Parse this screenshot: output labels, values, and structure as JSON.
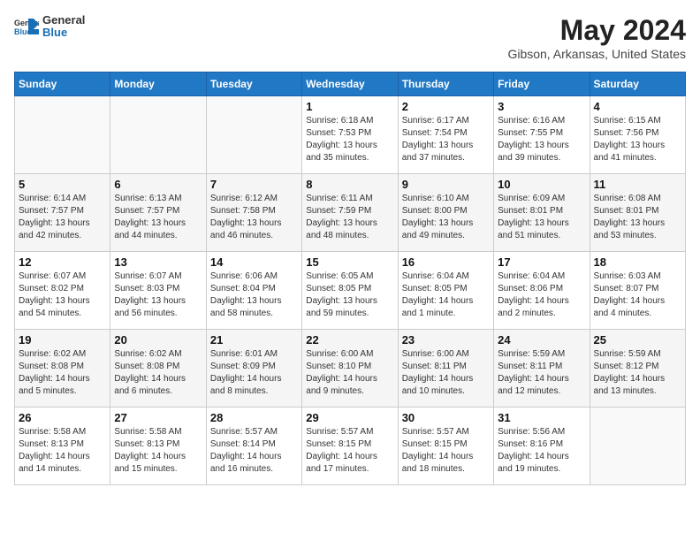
{
  "header": {
    "logo_general": "General",
    "logo_blue": "Blue",
    "month_year": "May 2024",
    "location": "Gibson, Arkansas, United States"
  },
  "days_of_week": [
    "Sunday",
    "Monday",
    "Tuesday",
    "Wednesday",
    "Thursday",
    "Friday",
    "Saturday"
  ],
  "weeks": [
    [
      {
        "day": "",
        "info": ""
      },
      {
        "day": "",
        "info": ""
      },
      {
        "day": "",
        "info": ""
      },
      {
        "day": "1",
        "info": "Sunrise: 6:18 AM\nSunset: 7:53 PM\nDaylight: 13 hours\nand 35 minutes."
      },
      {
        "day": "2",
        "info": "Sunrise: 6:17 AM\nSunset: 7:54 PM\nDaylight: 13 hours\nand 37 minutes."
      },
      {
        "day": "3",
        "info": "Sunrise: 6:16 AM\nSunset: 7:55 PM\nDaylight: 13 hours\nand 39 minutes."
      },
      {
        "day": "4",
        "info": "Sunrise: 6:15 AM\nSunset: 7:56 PM\nDaylight: 13 hours\nand 41 minutes."
      }
    ],
    [
      {
        "day": "5",
        "info": "Sunrise: 6:14 AM\nSunset: 7:57 PM\nDaylight: 13 hours\nand 42 minutes."
      },
      {
        "day": "6",
        "info": "Sunrise: 6:13 AM\nSunset: 7:57 PM\nDaylight: 13 hours\nand 44 minutes."
      },
      {
        "day": "7",
        "info": "Sunrise: 6:12 AM\nSunset: 7:58 PM\nDaylight: 13 hours\nand 46 minutes."
      },
      {
        "day": "8",
        "info": "Sunrise: 6:11 AM\nSunset: 7:59 PM\nDaylight: 13 hours\nand 48 minutes."
      },
      {
        "day": "9",
        "info": "Sunrise: 6:10 AM\nSunset: 8:00 PM\nDaylight: 13 hours\nand 49 minutes."
      },
      {
        "day": "10",
        "info": "Sunrise: 6:09 AM\nSunset: 8:01 PM\nDaylight: 13 hours\nand 51 minutes."
      },
      {
        "day": "11",
        "info": "Sunrise: 6:08 AM\nSunset: 8:01 PM\nDaylight: 13 hours\nand 53 minutes."
      }
    ],
    [
      {
        "day": "12",
        "info": "Sunrise: 6:07 AM\nSunset: 8:02 PM\nDaylight: 13 hours\nand 54 minutes."
      },
      {
        "day": "13",
        "info": "Sunrise: 6:07 AM\nSunset: 8:03 PM\nDaylight: 13 hours\nand 56 minutes."
      },
      {
        "day": "14",
        "info": "Sunrise: 6:06 AM\nSunset: 8:04 PM\nDaylight: 13 hours\nand 58 minutes."
      },
      {
        "day": "15",
        "info": "Sunrise: 6:05 AM\nSunset: 8:05 PM\nDaylight: 13 hours\nand 59 minutes."
      },
      {
        "day": "16",
        "info": "Sunrise: 6:04 AM\nSunset: 8:05 PM\nDaylight: 14 hours\nand 1 minute."
      },
      {
        "day": "17",
        "info": "Sunrise: 6:04 AM\nSunset: 8:06 PM\nDaylight: 14 hours\nand 2 minutes."
      },
      {
        "day": "18",
        "info": "Sunrise: 6:03 AM\nSunset: 8:07 PM\nDaylight: 14 hours\nand 4 minutes."
      }
    ],
    [
      {
        "day": "19",
        "info": "Sunrise: 6:02 AM\nSunset: 8:08 PM\nDaylight: 14 hours\nand 5 minutes."
      },
      {
        "day": "20",
        "info": "Sunrise: 6:02 AM\nSunset: 8:08 PM\nDaylight: 14 hours\nand 6 minutes."
      },
      {
        "day": "21",
        "info": "Sunrise: 6:01 AM\nSunset: 8:09 PM\nDaylight: 14 hours\nand 8 minutes."
      },
      {
        "day": "22",
        "info": "Sunrise: 6:00 AM\nSunset: 8:10 PM\nDaylight: 14 hours\nand 9 minutes."
      },
      {
        "day": "23",
        "info": "Sunrise: 6:00 AM\nSunset: 8:11 PM\nDaylight: 14 hours\nand 10 minutes."
      },
      {
        "day": "24",
        "info": "Sunrise: 5:59 AM\nSunset: 8:11 PM\nDaylight: 14 hours\nand 12 minutes."
      },
      {
        "day": "25",
        "info": "Sunrise: 5:59 AM\nSunset: 8:12 PM\nDaylight: 14 hours\nand 13 minutes."
      }
    ],
    [
      {
        "day": "26",
        "info": "Sunrise: 5:58 AM\nSunset: 8:13 PM\nDaylight: 14 hours\nand 14 minutes."
      },
      {
        "day": "27",
        "info": "Sunrise: 5:58 AM\nSunset: 8:13 PM\nDaylight: 14 hours\nand 15 minutes."
      },
      {
        "day": "28",
        "info": "Sunrise: 5:57 AM\nSunset: 8:14 PM\nDaylight: 14 hours\nand 16 minutes."
      },
      {
        "day": "29",
        "info": "Sunrise: 5:57 AM\nSunset: 8:15 PM\nDaylight: 14 hours\nand 17 minutes."
      },
      {
        "day": "30",
        "info": "Sunrise: 5:57 AM\nSunset: 8:15 PM\nDaylight: 14 hours\nand 18 minutes."
      },
      {
        "day": "31",
        "info": "Sunrise: 5:56 AM\nSunset: 8:16 PM\nDaylight: 14 hours\nand 19 minutes."
      },
      {
        "day": "",
        "info": ""
      }
    ]
  ]
}
